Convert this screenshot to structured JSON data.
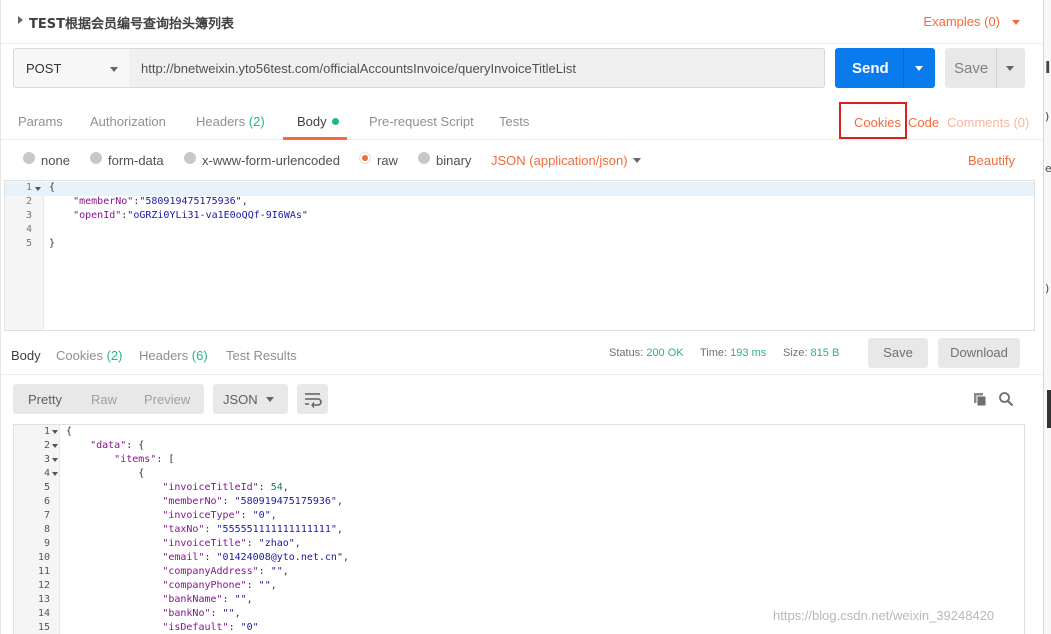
{
  "request": {
    "title": "TEST根据会员编号查询抬头簿列表",
    "examples_label": "Examples (0)",
    "method": "POST",
    "url": "http://bnetweixin.yto56test.com/officialAccountsInvoice/queryInvoiceTitleList",
    "send_label": "Send",
    "save_label": "Save"
  },
  "request_tabs": {
    "params": "Params",
    "authorization": "Authorization",
    "headers": "Headers",
    "headers_count": "(2)",
    "body": "Body",
    "prerequest": "Pre-request Script",
    "tests": "Tests",
    "cookies": "Cookies",
    "code": "Code",
    "comments": "Comments (0)"
  },
  "body_types": {
    "none": "none",
    "form_data": "form-data",
    "urlencoded": "x-www-form-urlencoded",
    "raw": "raw",
    "binary": "binary",
    "content_type": "JSON (application/json)",
    "beautify": "Beautify",
    "selected": "raw"
  },
  "request_body": [
    {
      "n": "1",
      "t": "{"
    },
    {
      "n": "2",
      "k": "\"memberNo\"",
      "v": "\"580919475175936\"",
      "tail": ","
    },
    {
      "n": "3",
      "k": "\"openId\"",
      "v": "\"oGRZi0YLi31-va1E0oQQf-9I6WAs\"",
      "tail": ""
    },
    {
      "n": "4",
      "t": ""
    },
    {
      "n": "5",
      "t": "}"
    }
  ],
  "response_tabs": {
    "body": "Body",
    "cookies": "Cookies",
    "cookies_count": "(2)",
    "headers": "Headers",
    "headers_count": "(6)",
    "test_results": "Test Results",
    "status_label": "Status:",
    "status_value": "200 OK",
    "time_label": "Time:",
    "time_value": "193 ms",
    "size_label": "Size:",
    "size_value": "815 B",
    "save": "Save",
    "download": "Download"
  },
  "response_format": {
    "pretty": "Pretty",
    "raw": "Raw",
    "preview": "Preview",
    "type": "JSON"
  },
  "response_body": [
    {
      "n": "1",
      "fold": true,
      "ind": "",
      "t": "{"
    },
    {
      "n": "2",
      "fold": true,
      "ind": "    ",
      "k": "\"data\"",
      "t": ": {"
    },
    {
      "n": "3",
      "fold": true,
      "ind": "        ",
      "k": "\"items\"",
      "t": ": ["
    },
    {
      "n": "4",
      "fold": true,
      "ind": "            ",
      "t": "{"
    },
    {
      "n": "5",
      "ind": "                ",
      "k": "\"invoiceTitleId\"",
      "num": "54",
      "tail": ","
    },
    {
      "n": "6",
      "ind": "                ",
      "k": "\"memberNo\"",
      "v": "\"580919475175936\"",
      "tail": ","
    },
    {
      "n": "7",
      "ind": "                ",
      "k": "\"invoiceType\"",
      "v": "\"0\"",
      "tail": ","
    },
    {
      "n": "8",
      "ind": "                ",
      "k": "\"taxNo\"",
      "v": "\"555551111111111111\"",
      "tail": ","
    },
    {
      "n": "9",
      "ind": "                ",
      "k": "\"invoiceTitle\"",
      "v": "\"zhao\"",
      "tail": ","
    },
    {
      "n": "10",
      "ind": "                ",
      "k": "\"email\"",
      "v": "\"01424008@yto.net.cn\"",
      "tail": ","
    },
    {
      "n": "11",
      "ind": "                ",
      "k": "\"companyAddress\"",
      "v": "\"\"",
      "tail": ","
    },
    {
      "n": "12",
      "ind": "                ",
      "k": "\"companyPhone\"",
      "v": "\"\"",
      "tail": ","
    },
    {
      "n": "13",
      "ind": "                ",
      "k": "\"bankName\"",
      "v": "\"\"",
      "tail": ","
    },
    {
      "n": "14",
      "ind": "                ",
      "k": "\"bankNo\"",
      "v": "\"\"",
      "tail": ","
    },
    {
      "n": "15",
      "ind": "                ",
      "k": "\"isDefault\"",
      "v": "\"0\"",
      "tail": ""
    }
  ],
  "watermark": "https://blog.csdn.net/weixin_39248420",
  "colors": {
    "accent": "#f26b3a",
    "send": "#097bed",
    "green": "#26b47f",
    "highlight_box": "#d9221c"
  },
  "icons": [
    "caret-right-icon",
    "chevron-down-icon",
    "copy-icon",
    "search-icon",
    "wrap-lines-icon"
  ]
}
